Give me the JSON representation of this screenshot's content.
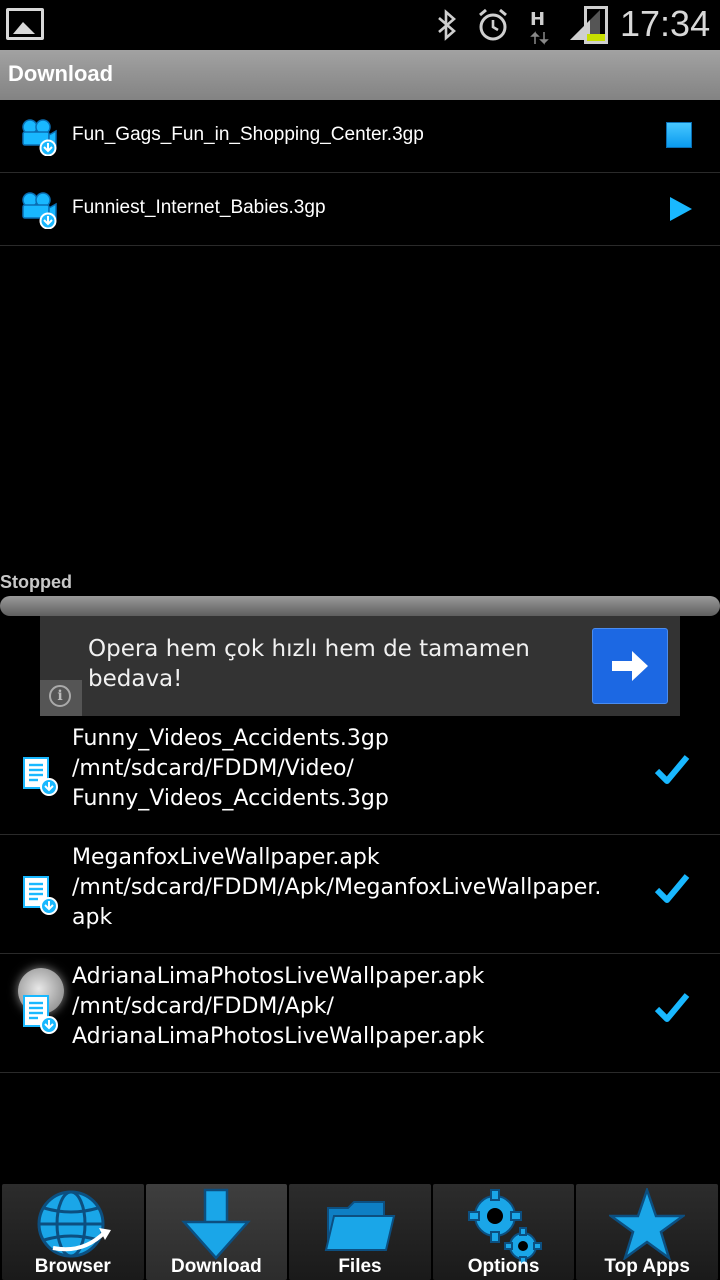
{
  "status_bar": {
    "time": "17:34",
    "network": "H",
    "icons": [
      "gallery-notification-icon",
      "bluetooth-icon",
      "alarm-icon",
      "h-data-icon",
      "signal-icon",
      "battery-icon"
    ]
  },
  "title_bar": {
    "title": "Download"
  },
  "active_downloads": [
    {
      "name": "Fun_Gags_Fun_in_Shopping_Center.3gp",
      "control": "stop"
    },
    {
      "name": "Funniest_Internet_Babies.3gp",
      "control": "play"
    }
  ],
  "status": {
    "label": "Stopped"
  },
  "ad": {
    "text": "Opera hem çok hızlı hem de tamamen bedava!"
  },
  "completed": [
    {
      "name": "Funny_Videos_Accidents.3gp",
      "path_line1": "/mnt/sdcard/FDDM/Video/",
      "path_line2": "Funny_Videos_Accidents.3gp"
    },
    {
      "name": "MeganfoxLiveWallpaper.apk",
      "path_line1": "/mnt/sdcard/FDDM/Apk/MeganfoxLiveWallpaper.",
      "path_line2": "apk"
    },
    {
      "name": "AdrianaLimaPhotosLiveWallpaper.apk",
      "path_line1": "/mnt/sdcard/FDDM/Apk/",
      "path_line2": "AdrianaLimaPhotosLiveWallpaper.apk"
    }
  ],
  "nav": [
    {
      "label": "Browser",
      "icon": "globe-icon"
    },
    {
      "label": "Download",
      "icon": "download-arrow-icon"
    },
    {
      "label": "Files",
      "icon": "folder-icon"
    },
    {
      "label": "Options",
      "icon": "gears-icon"
    },
    {
      "label": "Top Apps",
      "icon": "star-icon"
    }
  ],
  "colors": {
    "accent": "#19b8ff",
    "title_bar": "#9a9a9a",
    "ad_button": "#1c68e3"
  }
}
